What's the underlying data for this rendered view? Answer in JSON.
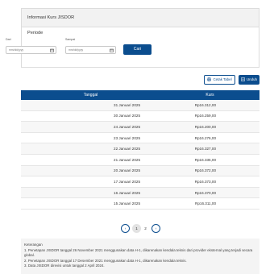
{
  "panel": {
    "title": "Informasi Kurs JISDOR",
    "periode_title": "Periode",
    "from_label": "Dari",
    "to_label": "Sampai",
    "from_placeholder": "mm/dd/yyyy",
    "to_placeholder": "mm/dd/yyyy",
    "search_label": "Cari"
  },
  "toolbar": {
    "print_label": "Cetak Tabel",
    "download_label": "Unduh"
  },
  "table": {
    "headers": [
      "Tanggal",
      "Kurs"
    ],
    "rows": [
      {
        "date": "31 Januari 2025",
        "rate": "Rp16.312,00"
      },
      {
        "date": "30 Januari 2025",
        "rate": "Rp16.259,00"
      },
      {
        "date": "24 Januari 2025",
        "rate": "Rp16.200,00"
      },
      {
        "date": "23 Januari 2025",
        "rate": "Rp16.276,00"
      },
      {
        "date": "22 Januari 2025",
        "rate": "Rp16.327,00"
      },
      {
        "date": "21 Januari 2025",
        "rate": "Rp16.335,00"
      },
      {
        "date": "20 Januari 2025",
        "rate": "Rp16.372,00"
      },
      {
        "date": "17 Januari 2025",
        "rate": "Rp16.373,00"
      },
      {
        "date": "16 Januari 2025",
        "rate": "Rp16.370,00"
      },
      {
        "date": "15 Januari 2025",
        "rate": "Rp16.311,00"
      }
    ]
  },
  "pagination": {
    "prev": "‹",
    "pages": [
      "1",
      "2"
    ],
    "next": "›"
  },
  "notes": {
    "title": "Keterangan",
    "lines": [
      "1. Penetapan JISDOR tanggal 26 November 2021 menggunakan data H-1, dikarenakan kendala teknis dari provider eksternal yang terjadi secara global.",
      "2. Penetapan JISDOR tanggal 17 Desember 2021 menggunakan data H-1, dikarenakan kendala teknis.",
      "3. Data JISDOR direvisi untuk tanggal 2 April 2024."
    ]
  },
  "colors": {
    "primary": "#0b4d8e",
    "header_bg": "#f2f2f2"
  },
  "icons": {
    "calendar": "calendar-icon",
    "print": "print-icon",
    "download": "download-icon"
  }
}
